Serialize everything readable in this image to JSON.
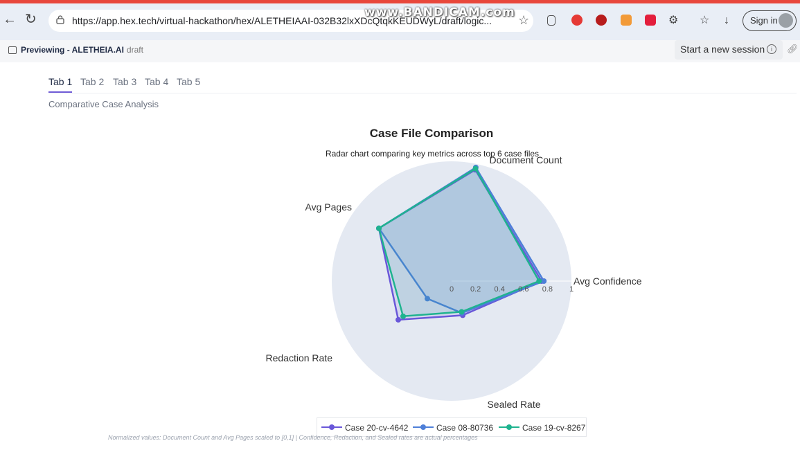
{
  "browser": {
    "url": "https://app.hex.tech/virtual-hackathon/hex/ALETHEIAAI-032B32lxXDcQtqkKEUDWyL/draft/logic...",
    "watermark": "www.BANDICAM.com",
    "sign_in_label": "Sign in"
  },
  "app_header": {
    "title": "Previewing - ALETHEIA.AI",
    "status": "draft",
    "session_button": "Start a new session"
  },
  "tabs": [
    {
      "label": "Tab 1",
      "active": true
    },
    {
      "label": "Tab 2",
      "active": false
    },
    {
      "label": "Tab 3",
      "active": false
    },
    {
      "label": "Tab 4",
      "active": false
    },
    {
      "label": "Tab 5",
      "active": false
    }
  ],
  "section_title": "Comparative Case Analysis",
  "chart_data": {
    "type": "radar",
    "title": "Case File Comparison",
    "subtitle": "Radar chart comparing key metrics across top 6 case files",
    "axes": [
      "Document Count",
      "Avg Confidence",
      "Sealed Rate",
      "Redaction Rate",
      "Avg Pages"
    ],
    "radial_range": [
      0,
      1
    ],
    "radial_ticks": [
      "0",
      "0.2",
      "0.4",
      "0.6",
      "0.8",
      "1"
    ],
    "series": [
      {
        "name": "Case 20-cv-4642",
        "color": "#6957d9",
        "values": [
          0.95,
          0.75,
          0.3,
          0.55,
          0.75
        ]
      },
      {
        "name": "Case 08-80736",
        "color": "#4e7fd8",
        "values": [
          0.97,
          0.77,
          0.28,
          0.25,
          0.75
        ]
      },
      {
        "name": "Case 19-cv-8267",
        "color": "#1fb38f",
        "values": [
          0.96,
          0.73,
          0.27,
          0.5,
          0.75
        ]
      }
    ],
    "footnote": "Normalized values: Document Count and Avg Pages scaled to [0,1] | Confidence, Redaction, and Sealed rates are actual percentages",
    "legend_position": "bottom"
  }
}
